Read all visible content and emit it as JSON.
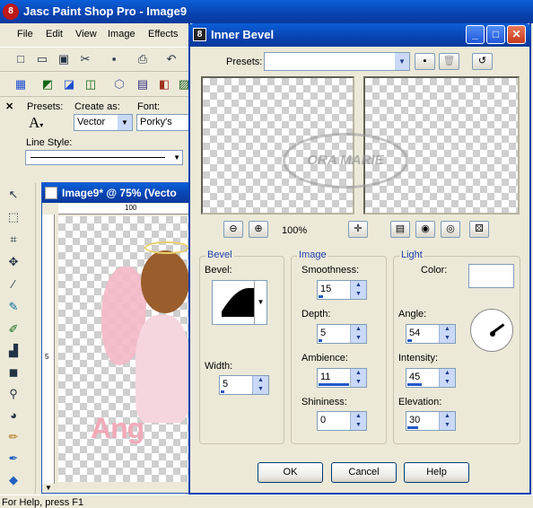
{
  "app": {
    "title": "Jasc Paint Shop Pro - Image9",
    "menu": [
      "File",
      "Edit",
      "View",
      "Image",
      "Effects"
    ],
    "tool_options": {
      "presets_label": "Presets:",
      "create_as_label": "Create as:",
      "create_as_value": "Vector",
      "font_label": "Font:",
      "font_value": "Porky's",
      "line_style_label": "Line Style:"
    },
    "image_window": {
      "title": "Image9* @  75% (Vecto",
      "ruler_top": [
        "100"
      ],
      "ruler_left": [
        "5"
      ],
      "canvas_text": "Ang"
    },
    "status": "For Help, press F1"
  },
  "dialog": {
    "title": "Inner Bevel",
    "presets_label": "Presets:",
    "presets_value": "",
    "watermark": "ORA MARIE",
    "zoom": "100%",
    "bevel": {
      "title": "Bevel",
      "bevel_label": "Bevel:",
      "width_label": "Width:",
      "width": "5",
      "width_fraction": 0.1
    },
    "image": {
      "title": "Image",
      "smoothness_label": "Smoothness:",
      "smoothness": "15",
      "smoothness_fraction": 0.15,
      "depth_label": "Depth:",
      "depth": "5",
      "depth_fraction": 0.1,
      "ambience_label": "Ambience:",
      "ambience": "11",
      "ambience_fraction": 0.95,
      "shininess_label": "Shininess:",
      "shininess": "0",
      "shininess_fraction": 0.0
    },
    "light": {
      "title": "Light",
      "color_label": "Color:",
      "color": "#ffffff",
      "angle_label": "Angle:",
      "angle": "54",
      "angle_fraction": 0.15,
      "intensity_label": "Intensity:",
      "intensity": "45",
      "intensity_fraction": 0.45,
      "elevation_label": "Elevation:",
      "elevation": "30",
      "elevation_fraction": 0.33
    },
    "buttons": {
      "ok": "OK",
      "cancel": "Cancel",
      "help": "Help"
    }
  },
  "colors": {
    "titlebar": "#0842b0",
    "face": "#ece9d8",
    "accent": "#2458c9"
  }
}
